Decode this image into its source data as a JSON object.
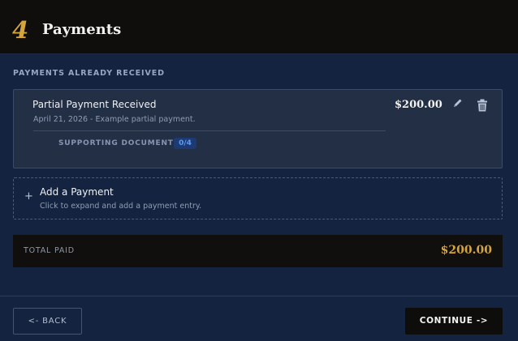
{
  "header": {
    "step_number": "4",
    "title": "Payments"
  },
  "received_section": {
    "label": "PAYMENTS ALREADY RECEIVED",
    "payments": [
      {
        "title": "Partial Payment Received",
        "subtitle": "April 21, 2026 - Example partial payment.",
        "amount": "$200.00",
        "documents_label": "SUPPORTING DOCUMENTS",
        "documents_count": "0/4",
        "edit_icon": "pencil-icon",
        "delete_icon": "trash-icon"
      }
    ]
  },
  "add_payment": {
    "icon": "plus-icon",
    "title": "Add a Payment",
    "subtitle": "Click to expand and add a payment entry."
  },
  "total": {
    "label": "TOTAL PAID",
    "value": "$200.00"
  },
  "footer": {
    "back_label": "<- BACK",
    "continue_label": "CONTINUE ->"
  },
  "colors": {
    "accent_gold": "#d4a53d",
    "page_background": "#14233f",
    "badge_blue": "#5b9cf5"
  }
}
